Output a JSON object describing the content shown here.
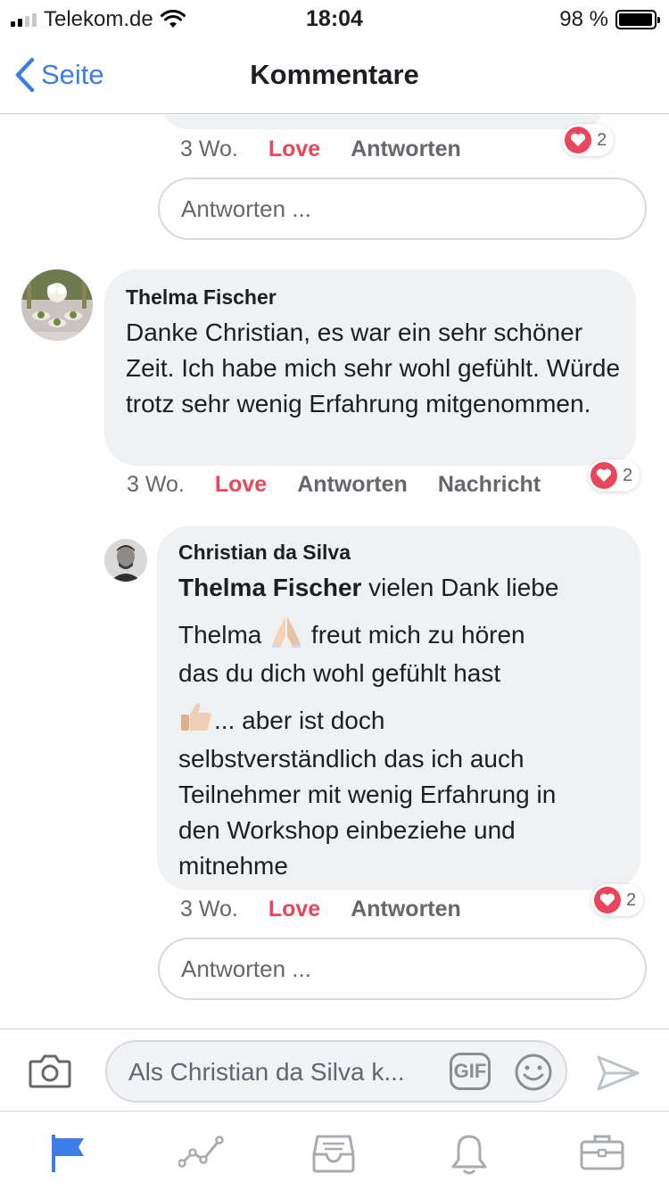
{
  "status_bar": {
    "carrier": "Telekom.de",
    "time": "18:04",
    "battery_percent": "98 %",
    "battery_level": 0.98
  },
  "nav": {
    "back_label": "Seite",
    "title": "Kommentare"
  },
  "comments": [
    {
      "time": "3 Wo.",
      "love_label": "Love",
      "reply_label": "Antworten",
      "reaction_count": "2"
    },
    {
      "author": "Thelma Fischer",
      "text": "Danke Christian, es war ein sehr schöner Zeit. Ich habe mich sehr wohl gefühlt. Würde trotz sehr wenig Erfahrung mitgenommen.",
      "time": "3 Wo.",
      "love_label": "Love",
      "reply_label": "Antworten",
      "message_label": "Nachricht",
      "reaction_count": "2"
    },
    {
      "author": "Christian da Silva",
      "mention": "Thelma Fischer",
      "text_part1": " vielen Dank liebe",
      "text_part2": "Thelma",
      "text_part3": " freut mich zu hören",
      "text_part4": "das du dich wohl gefühlt hast",
      "text_part5": "... aber ist doch",
      "text_part6": "selbstverständlich das ich auch",
      "text_part7": "Teilnehmer mit wenig Erfahrung in",
      "text_part8": "den Workshop einbeziehe und",
      "text_part9": "mitnehme",
      "time": "3 Wo.",
      "love_label": "Love",
      "reply_label": "Antworten",
      "reaction_count": "2"
    }
  ],
  "reply_placeholder": "Antworten ...",
  "composer": {
    "placeholder": "Als Christian da Silva k...",
    "gif_label": "GIF"
  },
  "tabbar": {
    "items": [
      "flag-icon",
      "insights-icon",
      "inbox-icon",
      "bell-icon",
      "briefcase-icon"
    ],
    "active_color": "#3b7ee8"
  },
  "colors": {
    "accent": "#3b7ee8",
    "love": "#e8465a",
    "bubble": "#f0f1f3"
  }
}
